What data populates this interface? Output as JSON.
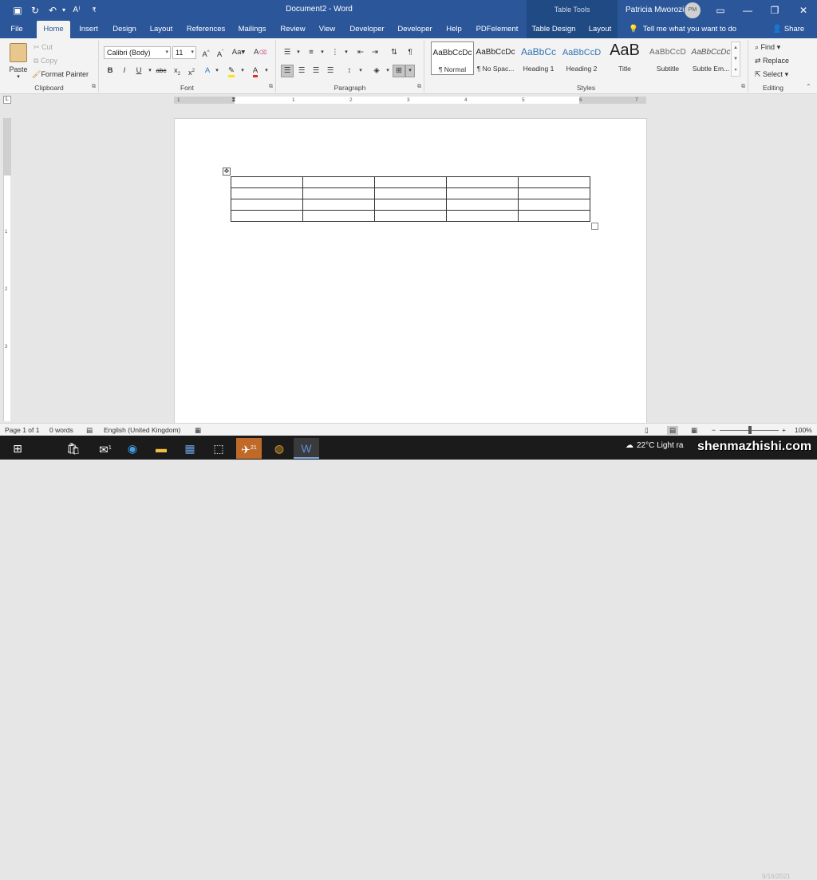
{
  "titlebar": {
    "doc_title": "Document2  -  Word",
    "context_group": "Table Tools",
    "user_name": "Patricia Mworozi",
    "avatar_initials": "PM"
  },
  "tabs": [
    {
      "label": "File"
    },
    {
      "label": "Home"
    },
    {
      "label": "Insert"
    },
    {
      "label": "Design"
    },
    {
      "label": "Layout"
    },
    {
      "label": "References"
    },
    {
      "label": "Mailings"
    },
    {
      "label": "Review"
    },
    {
      "label": "View"
    },
    {
      "label": "Developer"
    },
    {
      "label": "Developer"
    },
    {
      "label": "Help"
    },
    {
      "label": "PDFelement"
    },
    {
      "label": "Table Design"
    },
    {
      "label": "Layout"
    }
  ],
  "tellme": "Tell me what you want to do",
  "share": "Share",
  "clipboard": {
    "label": "Clipboard",
    "paste": "Paste",
    "cut": "Cut",
    "copy": "Copy",
    "format_painter": "Format Painter"
  },
  "font": {
    "label": "Font",
    "family": "Calibri (Body)",
    "size": "11",
    "case_btn": "Aa"
  },
  "paragraph": {
    "label": "Paragraph"
  },
  "styles": {
    "label": "Styles",
    "items": [
      {
        "preview": "AaBbCcDc",
        "name": "¶ Normal"
      },
      {
        "preview": "AaBbCcDc",
        "name": "¶ No Spac..."
      },
      {
        "preview": "AaBbCc",
        "name": "Heading 1"
      },
      {
        "preview": "AaBbCcD",
        "name": "Heading 2"
      },
      {
        "preview": "AaB",
        "name": "Title"
      },
      {
        "preview": "AaBbCcD",
        "name": "Subtitle"
      },
      {
        "preview": "AaBbCcDc",
        "name": "Subtle Em..."
      }
    ]
  },
  "editing": {
    "label": "Editing",
    "find": "Find",
    "replace": "Replace",
    "select": "Select"
  },
  "ruler_numbers": [
    "1",
    "1",
    "2",
    "3",
    "4",
    "5",
    "6",
    "7"
  ],
  "vruler_numbers": [
    "1",
    "2",
    "3"
  ],
  "table": {
    "rows": 4,
    "cols": 5
  },
  "status": {
    "page": "Page 1 of 1",
    "words": "0 words",
    "language": "English (United Kingdom)",
    "zoom": "100%",
    "zoom_level": 100
  },
  "taskbar": {
    "weather": "22°C  Light ra",
    "mail_badge": "1",
    "app_badge": "21",
    "watermark": "shenmazhishi.com",
    "clock": "9/16/2021"
  },
  "colors": {
    "title_bar": "#2b579a",
    "context_band": "#1f4a84",
    "ribbon": "#f3f3f3",
    "canvas": "#e6e6e6",
    "taskbar": "#1b1b1b"
  }
}
